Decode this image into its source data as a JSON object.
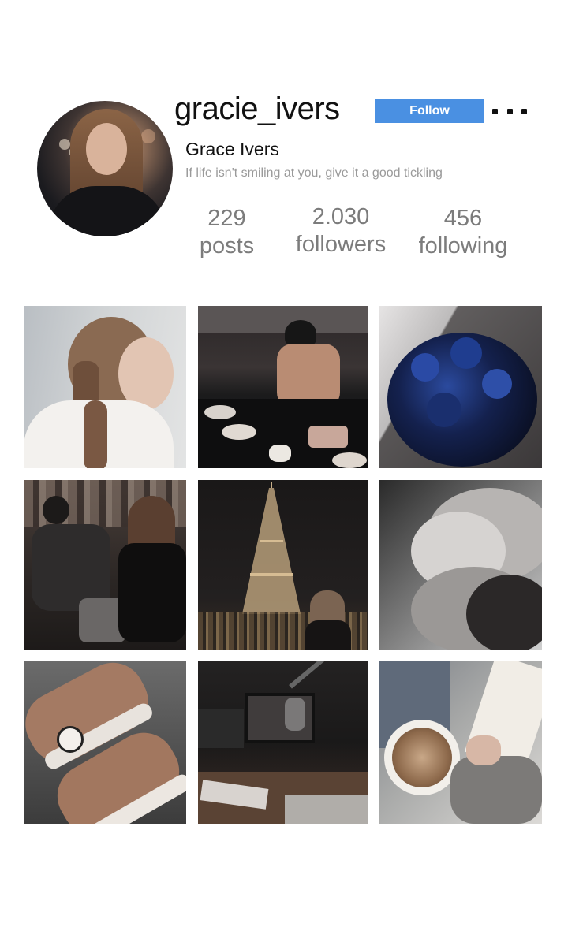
{
  "profile": {
    "username": "gracie_ivers",
    "display_name": "Grace Ivers",
    "bio": "If life isn't smiling at you, give it a good tickling",
    "follow_label": "Follow",
    "stats": {
      "posts": {
        "value": "229",
        "label": "posts"
      },
      "followers": {
        "value": "2.030",
        "label": "followers"
      },
      "following": {
        "value": "456",
        "label": "following"
      }
    }
  },
  "colors": {
    "follow_button": "#4a90e2",
    "stat_text": "#7c7c7c",
    "bio_text": "#9a9a9a"
  },
  "icons": {
    "more": "more-dots-icon"
  },
  "posts": [
    "girl-with-braid-photo",
    "man-kitchen-breakfast-photo",
    "blue-roses-bouquet-photo",
    "couple-in-shop-photo",
    "eiffel-tower-night-photo",
    "couple-close-up-photo",
    "converse-sneakers-photo",
    "radio-studio-photo",
    "coffee-cup-book-photo"
  ]
}
